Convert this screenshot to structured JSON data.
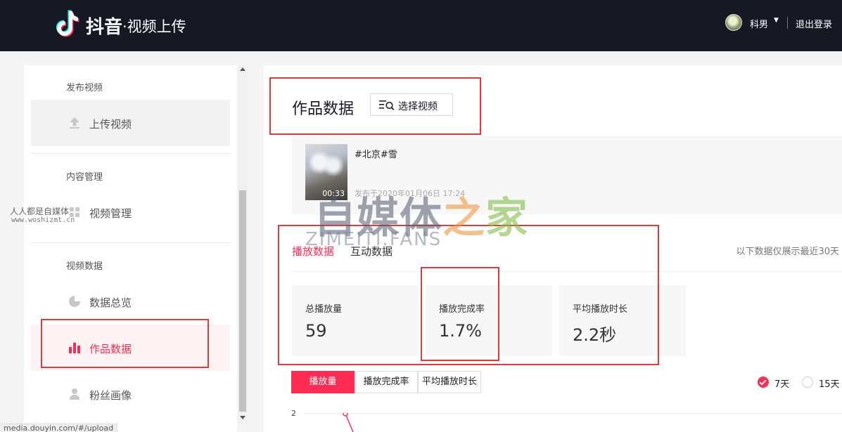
{
  "header": {
    "brand": "抖音",
    "subtitle": "·视频上传",
    "username": "科男",
    "logout_label": "退出登录"
  },
  "sidebar": {
    "sections": [
      {
        "title": "发布视频",
        "items": [
          {
            "label": "上传视频",
            "icon": "upload-icon"
          }
        ]
      },
      {
        "title": "内容管理",
        "items": [
          {
            "label": "视频管理",
            "icon": "video-manage-icon"
          }
        ]
      },
      {
        "title": "视频数据",
        "items": [
          {
            "label": "数据总览",
            "icon": "pie-chart-icon"
          },
          {
            "label": "作品数据",
            "icon": "bar-chart-icon",
            "active": true
          },
          {
            "label": "粉丝画像",
            "icon": "user-icon"
          }
        ]
      }
    ]
  },
  "main": {
    "title": "作品数据",
    "select_video_label": "选择视频",
    "video": {
      "title": "#北京#雪",
      "duration": "00:33",
      "published": "发布于2020年01月06日 17:24"
    },
    "tabs": [
      {
        "label": "播放数据",
        "active": true
      },
      {
        "label": "互动数据",
        "active": false
      }
    ],
    "tabs_note": "以下数据仅展示最近30天",
    "stats": [
      {
        "label": "总播放量",
        "value": "59"
      },
      {
        "label": "播放完成率",
        "value": "1.7%"
      },
      {
        "label": "平均播放时长",
        "value": "2.2秒"
      }
    ],
    "metric_buttons": [
      {
        "label": "播放量",
        "active": true
      },
      {
        "label": "播放完成率",
        "active": false
      },
      {
        "label": "平均播放时长",
        "active": false
      }
    ],
    "range_options": [
      {
        "label": "7天",
        "checked": true
      },
      {
        "label": "15天",
        "checked": false
      }
    ],
    "chart_y_tick": "2"
  },
  "watermark": {
    "site_name": "人人都是自媒体",
    "site_url": "www.woshizmt.cn",
    "brand_main": "自媒体",
    "brand_mid": "之",
    "brand_end": "家",
    "brand_en": "ZIMEITI.FANS"
  },
  "status_url": "media.douyin.com/#/upload",
  "colors": {
    "accent": "#fe2c55",
    "header_bg": "#161823",
    "highlight": "#e23a3a"
  }
}
